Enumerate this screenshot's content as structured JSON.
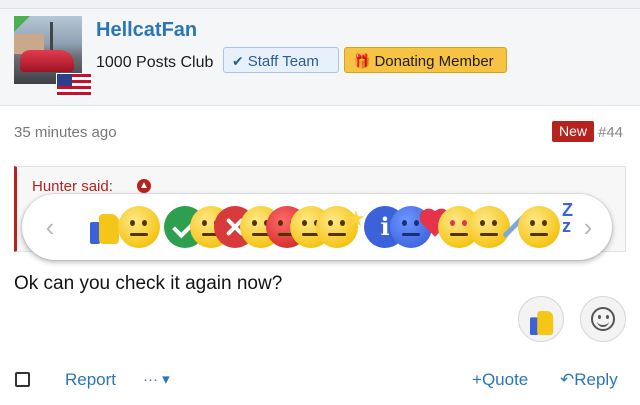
{
  "post": {
    "username": "HellcatFan",
    "user_title": "1000 Posts Club",
    "badges": {
      "staff": {
        "label": "Staff Team",
        "icon": "checkmark-icon"
      },
      "donor": {
        "label": "Donating Member",
        "icon": "gift-icon"
      }
    },
    "flag": "us-flag-icon",
    "timestamp": "35 minutes ago",
    "new_label": "New",
    "post_number": "#44",
    "message": "Ok can you check it again now?"
  },
  "quote": {
    "author": "Hunter said:",
    "icon": "arrow-up-circle-icon"
  },
  "reactions": {
    "prev_glyph": "‹",
    "next_glyph": "›",
    "items": [
      "like",
      "agree",
      "meh",
      "disagree",
      "sad",
      "cry",
      "happy",
      "winner",
      "informative",
      "confused",
      "love",
      "shocked",
      "useful",
      "sleepy"
    ]
  },
  "actions": {
    "report": "Report",
    "more": "···",
    "more_caret": "▾",
    "quote": "Quote",
    "reply": "Reply",
    "quote_icon": "+",
    "reply_icon": "↶"
  },
  "colors": {
    "link_blue": "#2b77b5",
    "new_red": "#b5231f",
    "donor_gold": "#f7c342",
    "staff_blue": "#e8f1fb"
  }
}
